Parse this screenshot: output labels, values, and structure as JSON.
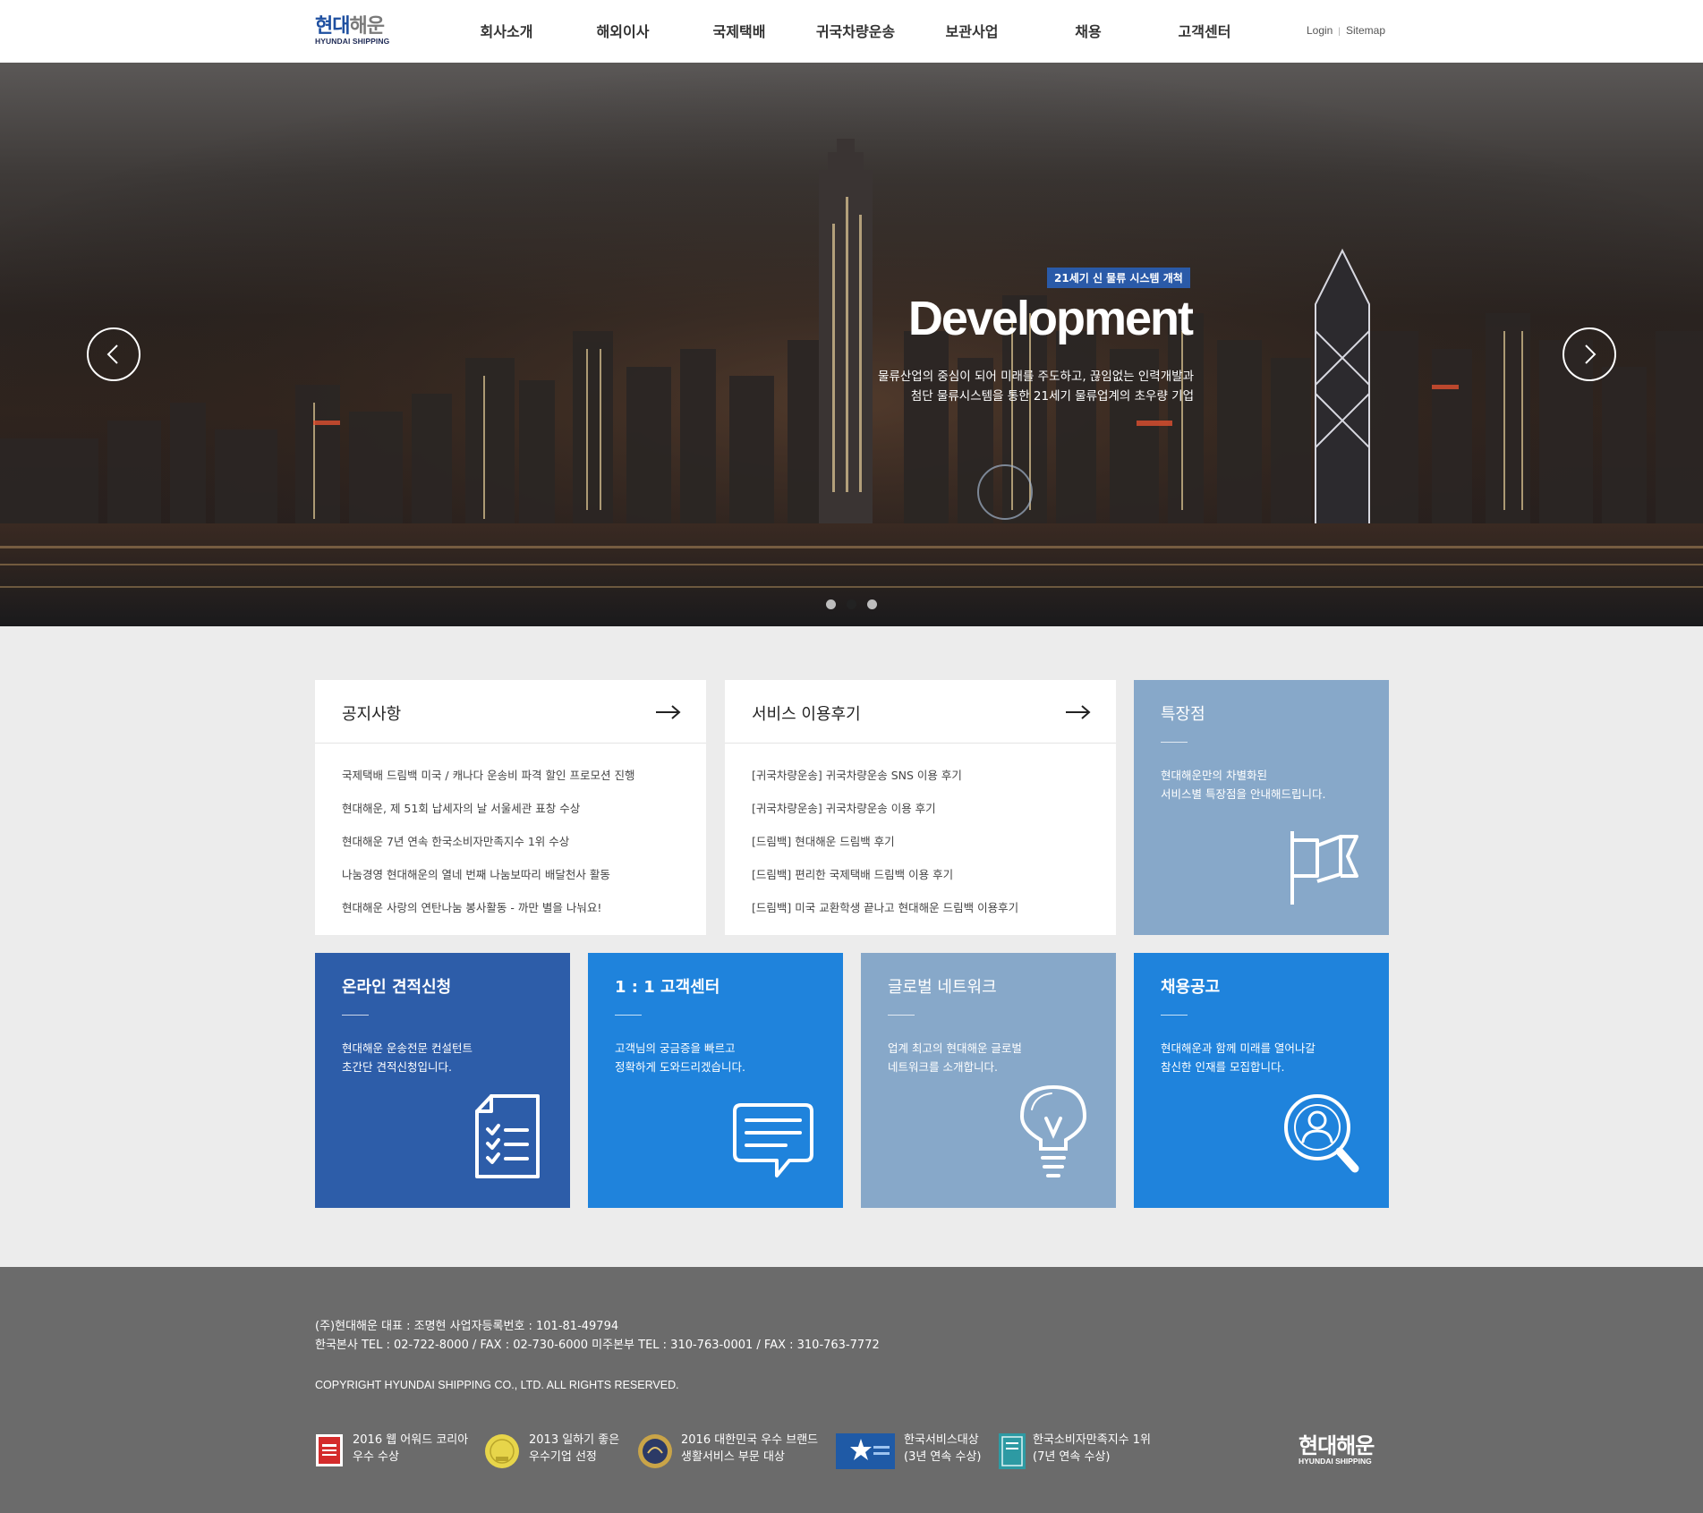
{
  "brand": {
    "name_ko_1": "현대",
    "name_ko_2": "해운",
    "name_en": "HYUNDAI SHIPPING"
  },
  "nav": {
    "items": [
      "회사소개",
      "해외이사",
      "국제택배",
      "귀국차량운송",
      "보관사업",
      "채용",
      "고객센터"
    ],
    "login": "Login",
    "sitemap": "Sitemap"
  },
  "hero": {
    "badge": "21세기 신 물류 시스템 개척",
    "title": "Development",
    "desc_line1": "물류산업의 중심이 되어 미래를 주도하고, 끊임없는 인력개발과",
    "desc_line2": "첨단 물류시스템을 통한 21세기 물류업계의 초우량 기업",
    "slide_count": 3,
    "active_slide": 2
  },
  "notice": {
    "title": "공지사항",
    "items": [
      "국제택배 드림백 미국 / 캐나다 운송비 파격 할인 프로모션 진행",
      "현대해운, 제 51회 납세자의 날 서울세관 표창 수상",
      "현대해운 7년 연속 한국소비자만족지수 1위 수상",
      "나눔경영 현대해운의 열네 번째 나눔보따리 배달천사 활동",
      "현대해운 사랑의 연탄나눔 봉사활동 - 까만 별을 나눠요!"
    ]
  },
  "review": {
    "title": "서비스 이용후기",
    "items": [
      "[귀국차량운송] 귀국차량운송 SNS 이용 후기",
      "[귀국차량운송] 귀국차량운송 이용 후기",
      "[드림백] 현대해운 드림백 후기",
      "[드림백] 편리한 국제택배 드림백 이용 후기",
      "[드림백] 미국 교환학생 끝나고 현대해운 드림백 이용후기"
    ]
  },
  "tiles": {
    "feature": {
      "title": "특장점",
      "desc1": "현대해운만의 차별화된",
      "desc2": "서비스별 특장점을 안내해드립니다.",
      "icon": "flag-icon",
      "color": "#87a8c9"
    },
    "estimate": {
      "title": "온라인 견적신청",
      "desc1": "현대해운 운송전문 컨설턴트",
      "desc2": "초간단 견적신청입니다.",
      "icon": "document-checklist-icon",
      "color": "#2d5da9"
    },
    "support": {
      "title": "1 : 1 고객센터",
      "desc1": "고객님의 궁금증을 빠르고",
      "desc2": "정확하게 도와드리겠습니다.",
      "icon": "chat-bubble-icon",
      "color": "#1f83dc"
    },
    "network": {
      "title": "글로벌 네트워크",
      "desc1": "업계 최고의 현대해운 글로벌",
      "desc2": "네트워크를 소개합니다.",
      "icon": "lightbulb-icon",
      "color": "#87a8c9"
    },
    "recruit": {
      "title": "채용공고",
      "desc1": "현대해운과 함께 미래를 열어나갈",
      "desc2": "참신한 인재를 모집합니다.",
      "icon": "person-search-icon",
      "color": "#1f83dc"
    }
  },
  "footer": {
    "line1": "(주)현대해운 대표 : 조명현 사업자등록번호 : 101-81-49794",
    "line2": "한국본사 TEL : 02-722-8000 / FAX : 02-730-6000 미주본부 TEL : 310-763-0001 / FAX : 310-763-7772",
    "copyright": "COPYRIGHT HYUNDAI SHIPPING CO., LTD. ALL RIGHTS RESERVED.",
    "awards": [
      {
        "line1": "2016 웹 어워드 코리아",
        "line2": "우수 수상"
      },
      {
        "line1": "2013 일하기 좋은",
        "line2": "우수기업 선정"
      },
      {
        "line1": "2016 대한민국 우수 브랜드",
        "line2": "생활서비스 부문 대상"
      },
      {
        "line1": "한국서비스대상",
        "line2": "(3년 연속 수상)"
      },
      {
        "line1": "한국소비자만족지수 1위",
        "line2": "(7년 연속 수상)"
      }
    ]
  }
}
